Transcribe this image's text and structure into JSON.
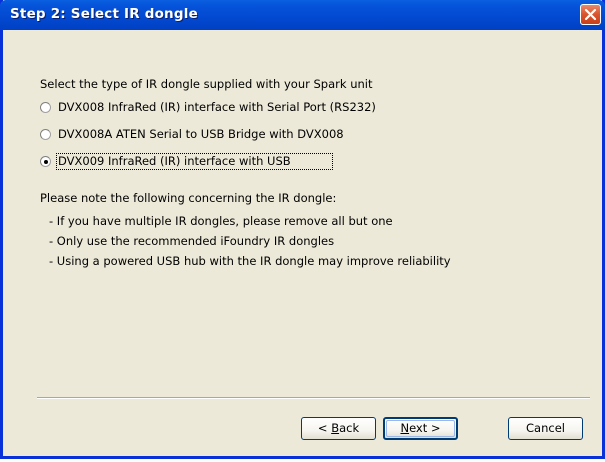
{
  "window": {
    "title": "Step 2: Select IR dongle"
  },
  "prompt": "Select the type of IR dongle supplied with your Spark unit",
  "options": [
    {
      "label": "DVX008 InfraRed (IR) interface with Serial Port (RS232)",
      "selected": false
    },
    {
      "label": "DVX008A ATEN Serial to USB Bridge with DVX008",
      "selected": false
    },
    {
      "label": "DVX009 InfraRed (IR) interface with USB",
      "selected": true
    }
  ],
  "notes": {
    "heading": "Please note the following concerning the IR dongle:",
    "items": [
      "- If you have multiple IR dongles, please remove all but one",
      "- Only use the recommended iFoundry IR dongles",
      "- Using a powered USB hub with the IR dongle may improve reliability"
    ]
  },
  "buttons": {
    "back_pre": "< ",
    "back_key": "B",
    "back_post": "ack",
    "next_key": "N",
    "next_post": "ext >",
    "cancel": "Cancel"
  },
  "colors": {
    "title_bar": "#0049d0",
    "dialog_bg": "#ece9d8",
    "close_button": "#d9532c"
  },
  "icons": {
    "close": "close-x-icon"
  }
}
